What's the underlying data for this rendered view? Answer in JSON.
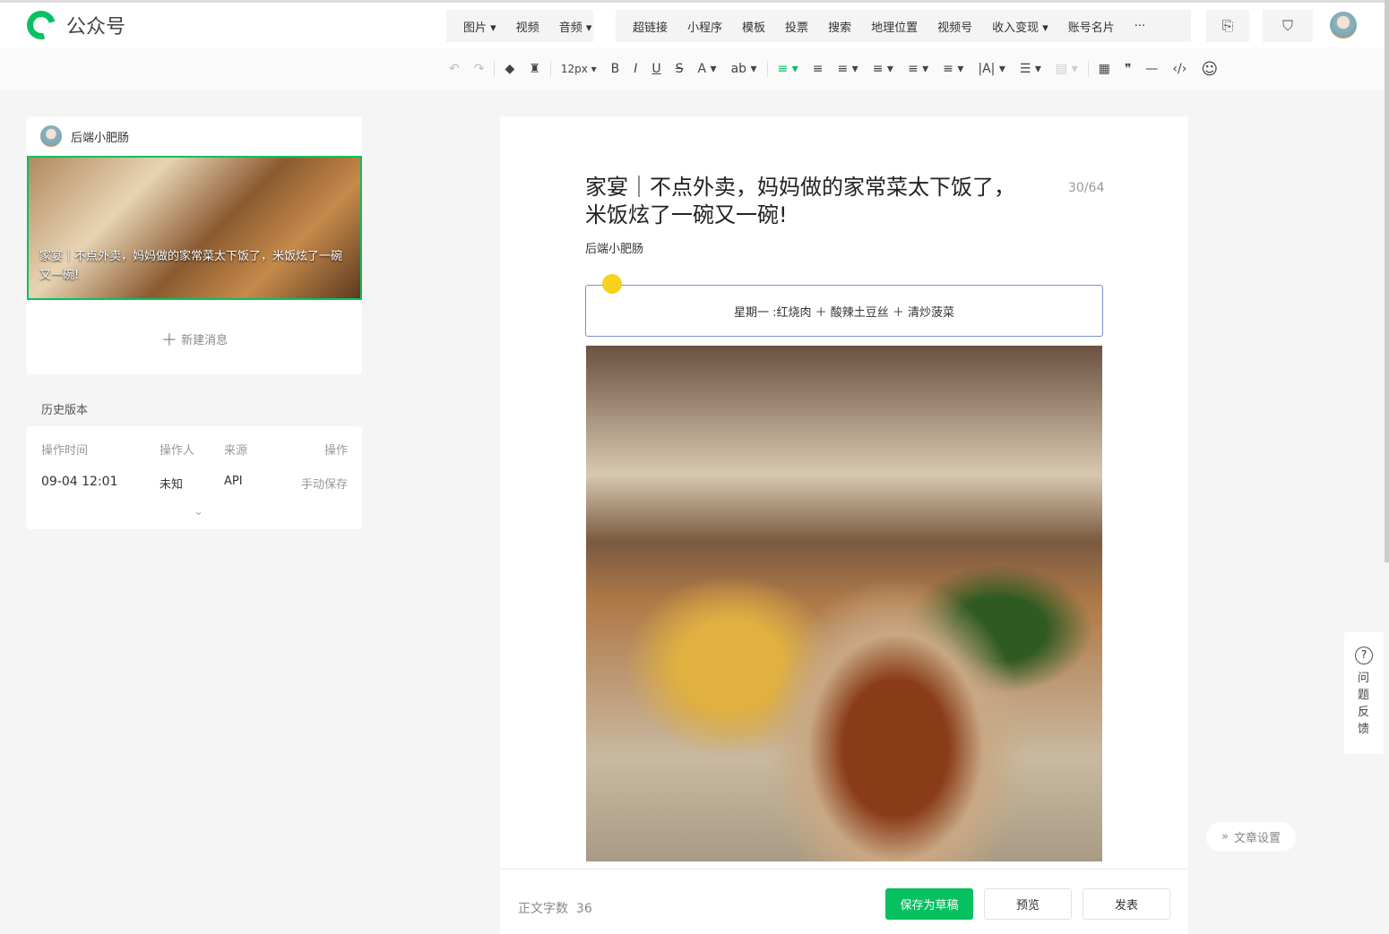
{
  "app": {
    "title": "公众号"
  },
  "nav": {
    "group1": [
      "图片 ▾",
      "视频",
      "音频 ▾"
    ],
    "group2": [
      "超链接",
      "小程序",
      "模板",
      "投票",
      "搜索",
      "地理位置",
      "视频号",
      "收入变现 ▾",
      "账号名片",
      "···"
    ]
  },
  "toolbar": {
    "undo": "↶",
    "redo": "↷",
    "font_size": "12px ▾",
    "items": [
      "B",
      "I",
      "U",
      "S",
      "A ▾",
      "ab ▾",
      "≡ ▾",
      "≡",
      "≡ ▾",
      "≡ ▾",
      "≡ ▾",
      "≡ ▾",
      "|A| ▾",
      "☰ ▾",
      "▤ ▾",
      "▦",
      "❞",
      "—",
      "‹/›",
      "☺"
    ]
  },
  "sidebar": {
    "account": "后端小肥肠",
    "article_cover_title": "家宴｜不点外卖，妈妈做的家常菜太下饭了，米饭炫了一碗又一碗!",
    "new_message": "新建消息",
    "history_title": "历史版本",
    "history_headers": [
      "操作时间",
      "操作人",
      "来源",
      "操作"
    ],
    "history_rows": [
      [
        "09-04 12:01",
        "未知",
        "API",
        "手动保存"
      ]
    ]
  },
  "editor": {
    "title": "家宴｜不点外卖，妈妈做的家常菜太下饭了，米饭炫了一碗又一碗!",
    "title_count": "30/64",
    "author": "后端小肥肠",
    "callout": "星期一 :红烧肉 ＋ 酸辣土豆丝 ＋ 清炒菠菜"
  },
  "footer": {
    "word_count_label": "正文字数",
    "word_count": "36",
    "save_draft": "保存为草稿",
    "preview": "预览",
    "publish": "发表"
  },
  "side_float": {
    "feedback": "问题反馈",
    "article_settings": "文章设置"
  },
  "colors": {
    "accent": "#07c160"
  }
}
